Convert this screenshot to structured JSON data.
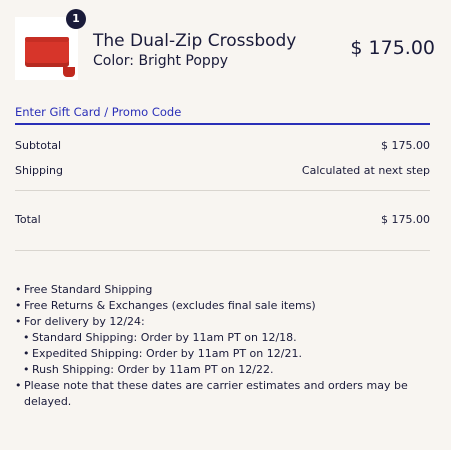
{
  "cart_item": {
    "quantity": "1",
    "name": "The Dual-Zip Crossbody",
    "color": "Color: Bright Poppy",
    "price": "$ 175.00",
    "image_color": "#d7352a"
  },
  "promo": {
    "link_label": "Enter Gift Card / Promo Code",
    "accent": "#2a2fb8"
  },
  "summary": {
    "subtotal_label": "Subtotal",
    "subtotal_value": "$ 175.00",
    "shipping_label": "Shipping",
    "shipping_value": "Calculated at next step",
    "total_label": "Total",
    "total_value": "$ 175.00"
  },
  "notes": [
    "Free Standard Shipping",
    "Free Returns & Exchanges (excludes final sale items)",
    "For delivery by 12/24:",
    "Standard Shipping: Order by 11am PT on 12/18.",
    "Expedited Shipping: Order by 11am PT on 12/21.",
    "Rush Shipping: Order by 11am PT on 12/22.",
    "Please note that these dates are carrier estimates and orders may be delayed."
  ]
}
